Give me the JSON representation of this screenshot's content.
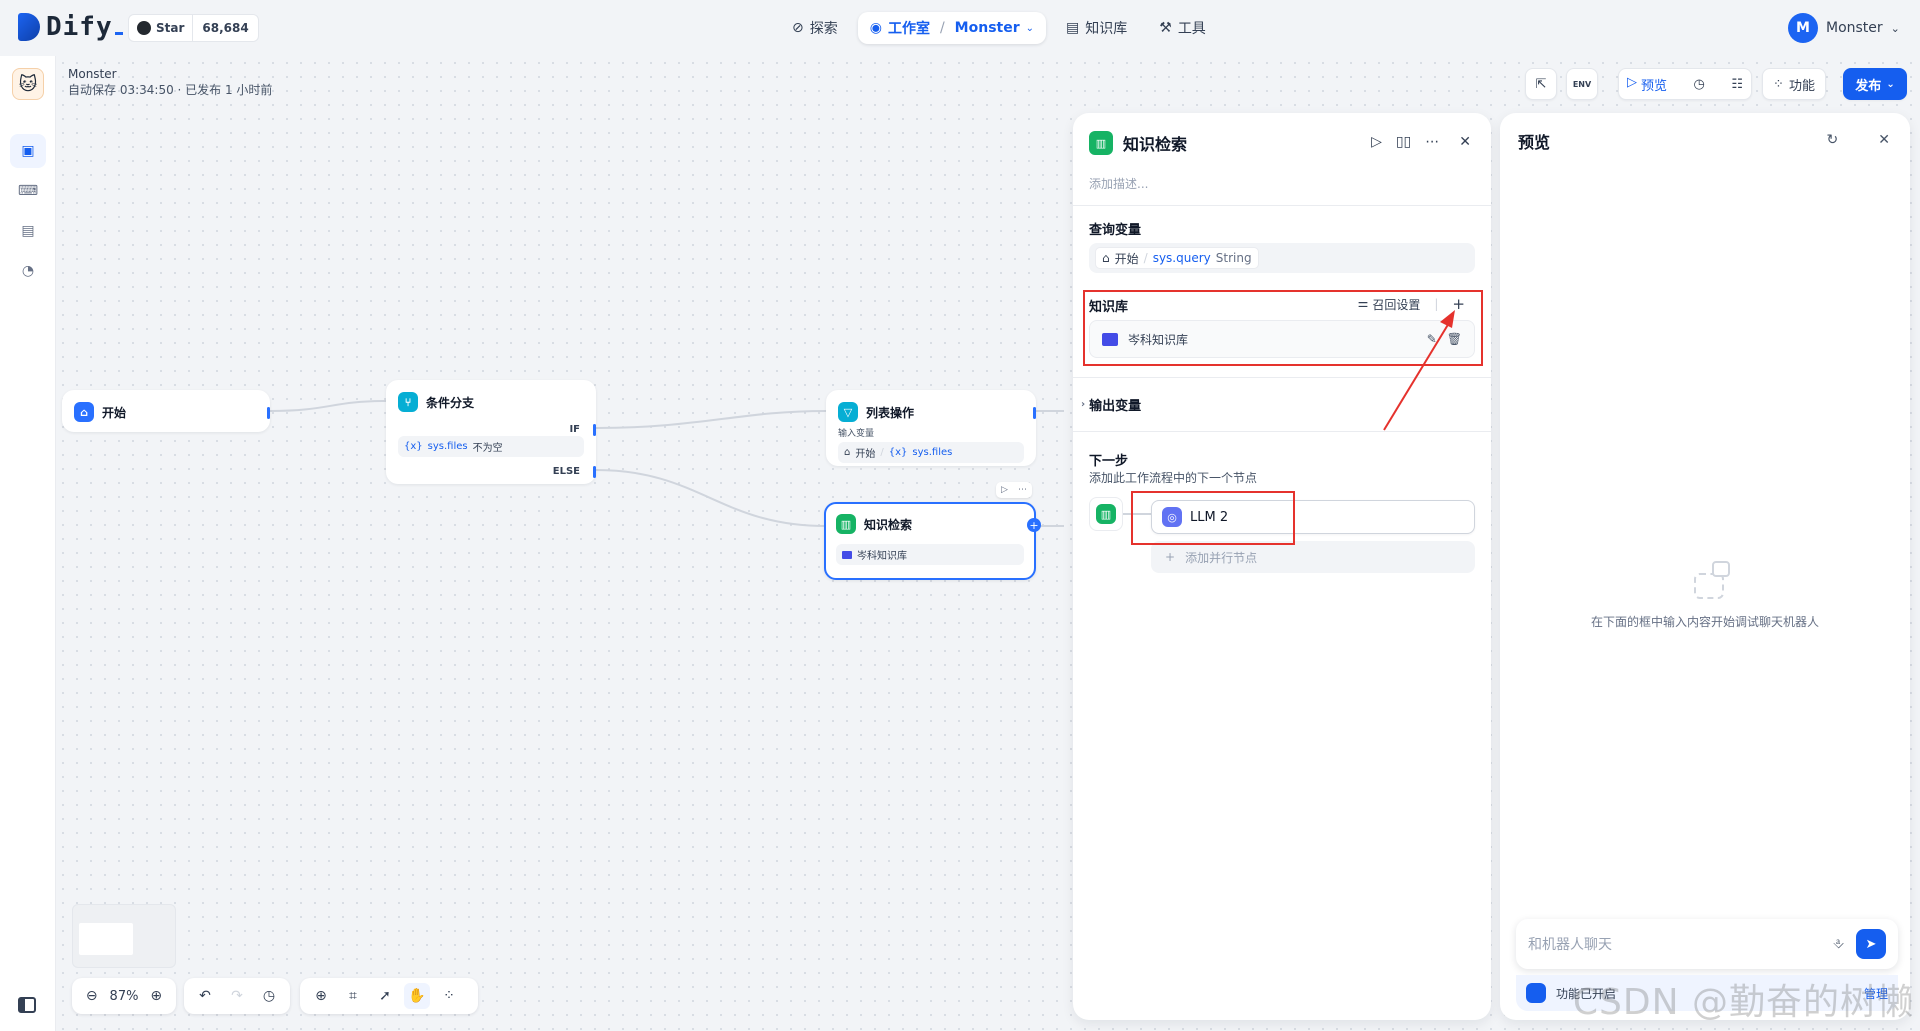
{
  "header": {
    "logo": "Dify",
    "github": {
      "star_label": "Star",
      "star_count": "68,684"
    },
    "nav": [
      {
        "label": "探索",
        "icon": "compass-icon"
      },
      {
        "label": "工作室",
        "icon": "robot-icon",
        "app": "Monster"
      },
      {
        "label": "知识库",
        "icon": "book-icon"
      },
      {
        "label": "工具",
        "icon": "hammer-icon"
      }
    ],
    "user": {
      "initial": "M",
      "name": "Monster"
    }
  },
  "app": {
    "name": "Monster",
    "status": "自动保存 03:34:50 · 已发布 1 小时前"
  },
  "toolbar": {
    "preview": "预览",
    "features": "功能",
    "publish": "发布",
    "env": "ENV"
  },
  "nodes": {
    "start": {
      "title": "开始"
    },
    "if_else": {
      "title": "条件分支",
      "condition_var": "sys.files",
      "condition_op": "不为空",
      "if_label": "IF",
      "else_label": "ELSE"
    },
    "list_op": {
      "title": "列表操作",
      "input_label": "输入变量",
      "source": "开始",
      "var": "sys.files"
    },
    "knowledge": {
      "title": "知识检索",
      "dataset": "岑科知识库"
    }
  },
  "canvas_controls": {
    "zoom": "87%"
  },
  "panel": {
    "title": "知识检索",
    "description_placeholder": "添加描述...",
    "query_label": "查询变量",
    "query_source": "开始",
    "query_var": "sys.query",
    "query_type": "String",
    "kb_label": "知识库",
    "recall_settings": "召回设置",
    "kb_item": "岑科知识库",
    "output_label": "输出变量",
    "next_label": "下一步",
    "next_desc": "添加此工作流程中的下一个节点",
    "next_node": "LLM 2",
    "add_parallel": "添加并行节点"
  },
  "preview": {
    "title": "预览",
    "empty_text": "在下面的框中输入内容开始调试聊天机器人",
    "input_placeholder": "和机器人聊天",
    "feature_text": "功能已开启",
    "feature_link": "管理"
  },
  "watermark": "CSDN @勤奋的树懒"
}
